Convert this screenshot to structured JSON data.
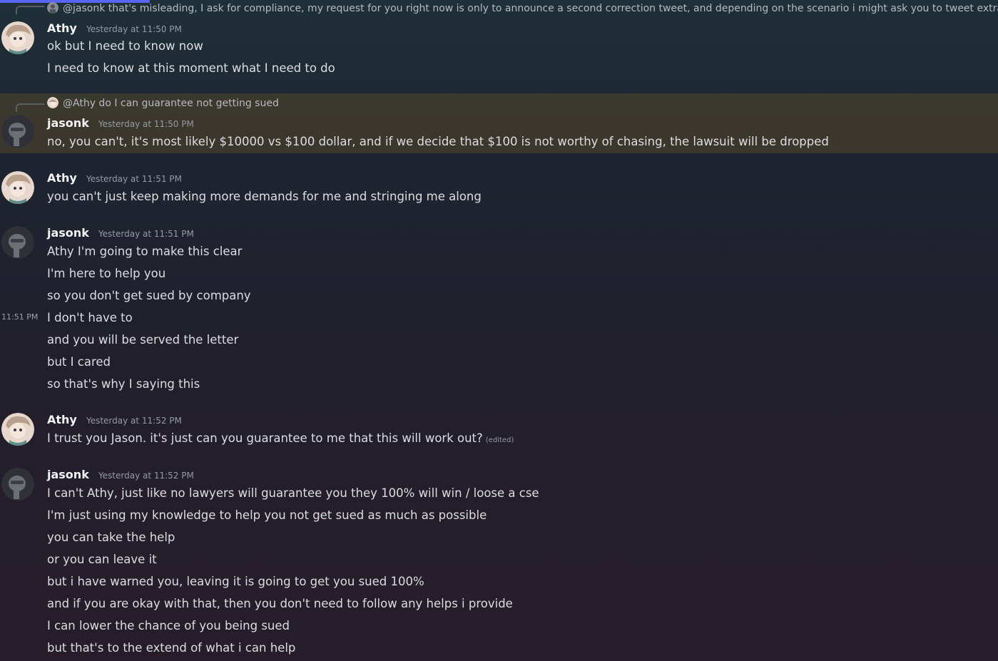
{
  "messages": [
    {
      "reply": "@jasonk that's misleading, I ask for compliance, my request for you right now is only to announce a second correction tweet, and depending on the scenario i might ask you to tweet extra",
      "author": "Athy",
      "time": "Yesterday at 11:50 PM",
      "lines": [
        "ok but I need to know now",
        "I need to know at this moment what I need to do"
      ]
    },
    {
      "reply": "@Athy do I can guarantee not getting sued",
      "author": "jasonk",
      "time": "Yesterday at 11:50 PM",
      "lines": [
        "no, you can't, it's most likely $10000 vs $100 dollar, and if we decide that $100 is not worthy of chasing, the lawsuit will be dropped"
      ]
    },
    {
      "author": "Athy",
      "time": "Yesterday at 11:51 PM",
      "lines": [
        "you can't just keep making more demands for me and stringing me along"
      ]
    },
    {
      "author": "jasonk",
      "time": "Yesterday at 11:51 PM",
      "hover_time": "11:51 PM",
      "lines": [
        "Athy I'm going to make this clear",
        "I'm here to help you",
        "so you don't get sued by company",
        "I don't have to",
        "and you will be served the letter",
        "but I cared",
        "so that's why I saying this"
      ]
    },
    {
      "author": "Athy",
      "time": "Yesterday at 11:52 PM",
      "lines": [
        "I trust you Jason. it's just can you guarantee to me that this will work out?"
      ],
      "edited": "(edited)"
    },
    {
      "author": "jasonk",
      "time": "Yesterday at 11:52 PM",
      "lines": [
        "I can't Athy, just like no lawyers will guarantee you they 100% will win / loose a cse",
        "I'm just using my knowledge to help you not get sued as much as possible",
        "you can take the help",
        "or you can leave it",
        "but i have warned you, leaving it is going to get you sued 100%",
        "and if you are okay with that, then you don't need to follow any helps i provide",
        "I can lower the chance of you being sued",
        "but that's to the extend of what i can help"
      ]
    }
  ],
  "colors": {
    "accent": "#5865f2",
    "highlight": "#463e2c",
    "username": "#f2f3f5",
    "timestamp": "#949ba4"
  }
}
